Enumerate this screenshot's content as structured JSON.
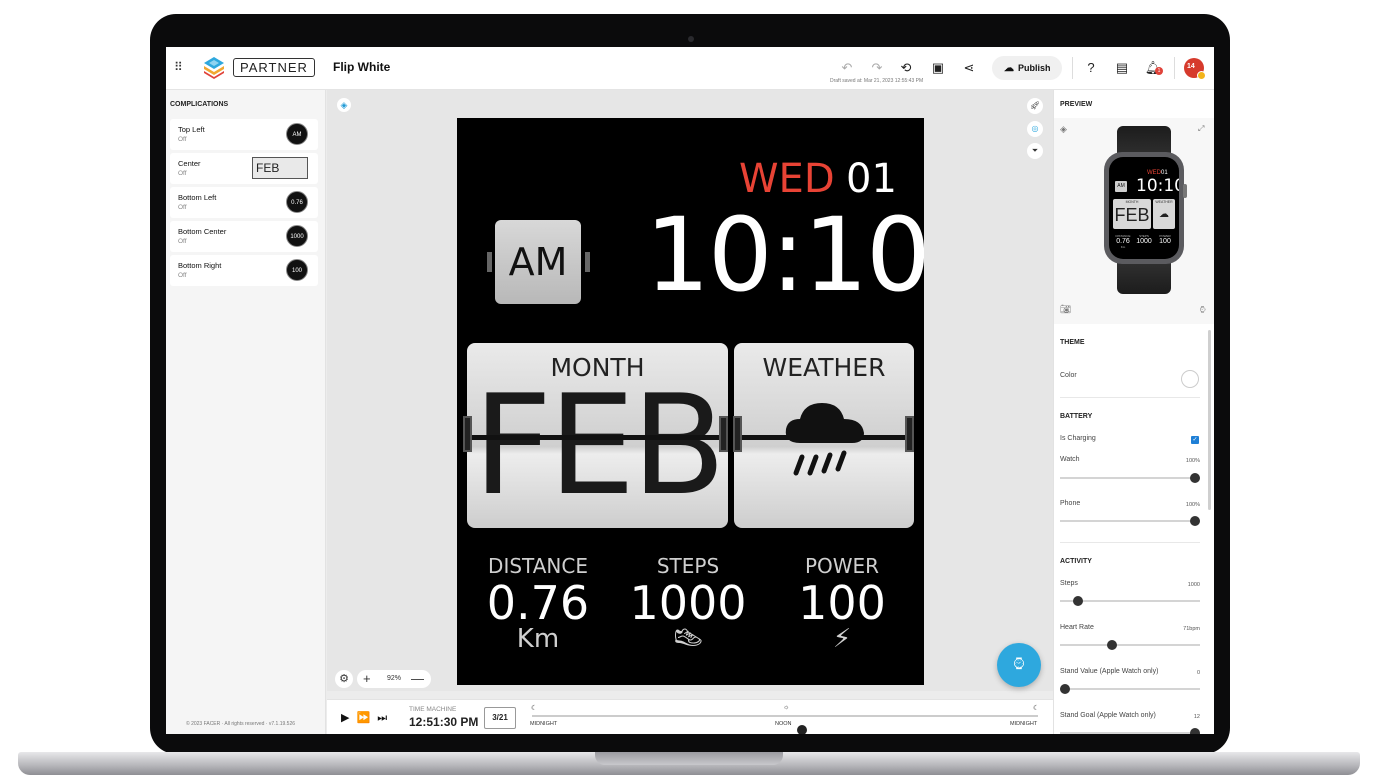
{
  "colors": {
    "accent_blue": "#2ea8de",
    "weekday_red": "#e84335",
    "avatar_red": "#d63a2c",
    "checkbox_blue": "#1f7fd6"
  },
  "header": {
    "apps_icon": "apps-grid-icon",
    "partner_label": "PARTNER",
    "project_title": "Flip White",
    "draft_saved": "Draft saved at: Mar 21, 2023 12:55:43 PM",
    "publish_label": "Publish",
    "icons": [
      "undo-icon",
      "redo-icon",
      "history-icon",
      "save-icon",
      "share-icon",
      "help-icon",
      "chat-icon",
      "notifications-icon"
    ],
    "notification_count": "1",
    "avatar_initials": "14"
  },
  "complications": {
    "title": "COMPLICATIONS",
    "items": [
      {
        "name": "Top Left",
        "status": "Off",
        "thumb": "AM"
      },
      {
        "name": "Center",
        "status": "Off",
        "thumb": "FEB"
      },
      {
        "name": "Bottom Left",
        "status": "Off",
        "thumb": "0.76"
      },
      {
        "name": "Bottom Center",
        "status": "Off",
        "thumb": "1000"
      },
      {
        "name": "Bottom Right",
        "status": "Off",
        "thumb": "100"
      }
    ],
    "copyright": "© 2023 FACER · All rights reserved · v7.1.19.526"
  },
  "watchface": {
    "weekday": "WED",
    "day": "01",
    "time": "10:10",
    "ampm": "AM",
    "month_label": "MONTH",
    "month_value": "FEB",
    "weather_label": "WEATHER",
    "stats": [
      {
        "label": "DISTANCE",
        "value": "0.76",
        "unit": "Km",
        "icon": ""
      },
      {
        "label": "STEPS",
        "value": "1000",
        "unit": "",
        "icon": "shoe-icon"
      },
      {
        "label": "POWER",
        "value": "100",
        "unit": "",
        "icon": "lightning-icon"
      }
    ]
  },
  "canvas": {
    "zoom": "92%",
    "zoom_in": "+",
    "zoom_out": "—"
  },
  "time_machine": {
    "label": "TIME MACHINE",
    "clock": "12:51:30 PM",
    "date": "3/21",
    "midnight_start": "MIDNIGHT",
    "noon": "NOON",
    "midnight_end": "MIDNIGHT",
    "position_fraction": 0.535
  },
  "preview": {
    "title": "PREVIEW",
    "mini": {
      "weekday": "WED",
      "day": "01",
      "time": "10:10",
      "ampm": "AM",
      "month": "FEB",
      "month_label": "MONTH",
      "weather_label": "WEATHER",
      "stats": [
        {
          "label": "DISTANCE",
          "value": "0.76",
          "unit": "Km"
        },
        {
          "label": "STEPS",
          "value": "1000",
          "unit": ""
        },
        {
          "label": "POWER",
          "value": "100",
          "unit": ""
        }
      ]
    }
  },
  "theme": {
    "title": "THEME",
    "color_label": "Color"
  },
  "battery": {
    "title": "BATTERY",
    "is_charging_label": "Is Charging",
    "is_charging": true,
    "watch_label": "Watch",
    "watch_value": "100%",
    "watch_fraction": 1.0,
    "phone_label": "Phone",
    "phone_value": "100%",
    "phone_fraction": 1.0
  },
  "activity": {
    "title": "ACTIVITY",
    "steps_label": "Steps",
    "steps_value": "1000",
    "steps_fraction": 0.1,
    "heart_label": "Heart Rate",
    "heart_value": "71bpm",
    "heart_fraction": 0.36,
    "stand_value_label": "Stand Value (Apple Watch only)",
    "stand_value": "0",
    "stand_value_fraction": 0.0,
    "stand_goal_label": "Stand Goal (Apple Watch only)",
    "stand_goal": "12",
    "stand_goal_fraction": 1.0
  }
}
